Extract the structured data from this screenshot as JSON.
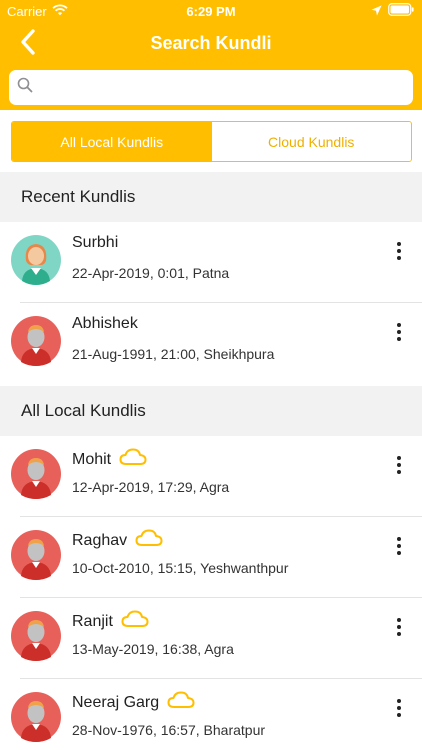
{
  "status_bar": {
    "carrier": "Carrier",
    "time": "6:29 PM",
    "icons": [
      "wifi-icon",
      "location-arrow-icon",
      "battery-icon"
    ]
  },
  "nav": {
    "title": "Search Kundli",
    "back_icon": "chevron-left-icon"
  },
  "search": {
    "placeholder": "",
    "value": "",
    "icon": "search-icon"
  },
  "tabs": [
    {
      "label": "All Local Kundlis",
      "active": true
    },
    {
      "label": "Cloud Kundlis",
      "active": false
    }
  ],
  "sections": {
    "recent": {
      "title": "Recent Kundlis",
      "items": [
        {
          "name": "Surbhi",
          "detail": "22-Apr-2019, 0:01, Patna",
          "avatar": "female-avatar",
          "cloud": false
        },
        {
          "name": "Abhishek",
          "detail": "21-Aug-1991, 21:00, Sheikhpura",
          "avatar": "male-avatar",
          "cloud": false
        }
      ]
    },
    "local": {
      "title": "All Local Kundlis",
      "items": [
        {
          "name": "Mohit",
          "detail": "12-Apr-2019, 17:29, Agra",
          "avatar": "male-avatar",
          "cloud": true
        },
        {
          "name": "Raghav",
          "detail": "10-Oct-2010, 15:15, Yeshwanthpur",
          "avatar": "male-avatar",
          "cloud": true
        },
        {
          "name": "Ranjit",
          "detail": "13-May-2019, 16:38, Agra",
          "avatar": "male-avatar",
          "cloud": true
        },
        {
          "name": "Neeraj Garg",
          "detail": "28-Nov-1976, 16:57, Bharatpur",
          "avatar": "male-avatar",
          "cloud": true
        }
      ]
    }
  },
  "colors": {
    "accent": "#ffbf00",
    "section_bg": "#f2f2f2",
    "male_avatar_bg": "#e8605a",
    "female_avatar_bg": "#7fd6c4"
  }
}
